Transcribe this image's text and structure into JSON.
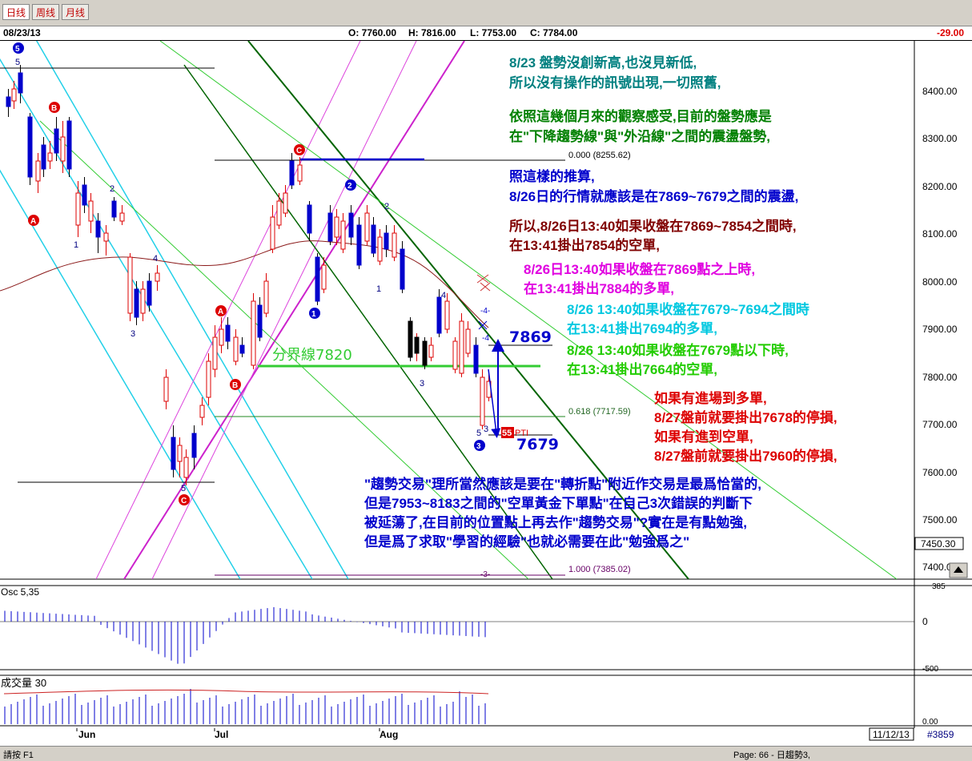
{
  "toolbar": {
    "tabs": [
      "日线",
      "周线",
      "月线"
    ],
    "active_tab": "日线"
  },
  "info": {
    "date": "08/23/13",
    "open": "O: 7760.00",
    "high": "H: 7816.00",
    "low": "L: 7753.00",
    "close": "C: 7784.00",
    "change": "-29.00"
  },
  "price_axis": {
    "labels": [
      "8400.00",
      "8300.00",
      "8200.00",
      "8100.00",
      "8000.00",
      "7900.00",
      "7800.00",
      "7700.00",
      "7600.00",
      "7500.00",
      "7400.00"
    ],
    "current_price": "7450.30"
  },
  "fib": {
    "level_0": "0.000 (8255.62)",
    "level_618": "0.618 (7717.59)",
    "level_1": "1.000 (7385.02)"
  },
  "chart_labels": {
    "boundary_line": "分界線7820",
    "target_high": "7869",
    "target_low": "7679",
    "pti_number": "55",
    "pti_text": "PTI",
    "channel_mark_4a": "-4-",
    "channel_mark_4b": "-4",
    "channel_mark_3": "-3-"
  },
  "wave_labels": {
    "circle_5": "5",
    "small_5_top": "5",
    "B1": "B",
    "A1": "A",
    "C1": "C",
    "circle_2": "2",
    "circle_1": "1",
    "A2": "A",
    "B2": "B",
    "C2": "C",
    "circle_3": "3",
    "w2a": "2",
    "w1a": "1",
    "w4a": "4",
    "w3a": "3",
    "w5a": "5",
    "w2b": "2",
    "w1b": "1",
    "w4b": "4",
    "w3b": "3",
    "w5b": "5",
    "w3c": "3"
  },
  "annotations": {
    "p1_l1": "8/23 盤勢沒創新高,也沒見新低,",
    "p1_l2": "所以沒有操作的訊號出現,一切照舊,",
    "p2_l1": "依照這幾個月來的觀察感受,目前的盤勢應是",
    "p2_l2": "在\"下降趨勢線\"與\"外沿線\"之間的震盪盤勢,",
    "p3_l1": "照這樣的推算,",
    "p3_l2": "8/26日的行情就應該是在7869~7679之間的震盪,",
    "p4_l1": "所以,8/26日13:40如果收盤在7869~7854之間時,",
    "p4_l2": "在13:41掛出7854的空單,",
    "p5_l1": "8/26日13:40如果收盤在7869點之上時,",
    "p5_l2": "在13:41掛出7884的多單,",
    "p6_l1": "8/26 13:40如果收盤在7679~7694之間時",
    "p6_l2": "在13:41掛出7694的多單,",
    "p7_l1": "8/26 13:40如果收盤在7679點以下時,",
    "p7_l2": "在13:41掛出7664的空單,",
    "p8_l1": "如果有進場到多單,",
    "p8_l2": "8/27盤前就要掛出7678的停損,",
    "p8_l3": "如果有進到空單,",
    "p8_l4": "8/27盤前就要掛出7960的停損,",
    "p9_l1": "\"趨勢交易\"理所當然應該是要在\"轉折點\"附近作交易是最爲恰當的,",
    "p9_l2": "但是7953~8183之間的\"空單黃金下單點\"在自己3次錯誤的判斷下",
    "p9_l3": "被延蕩了,在目前的位置點上再去作\"趨勢交易\"?實在是有點勉強,",
    "p9_l4": "但是爲了求取\"學習的經驗\"也就必需要在此\"勉強爲之\""
  },
  "osc": {
    "title": "Osc 5,35",
    "axis_top": "385",
    "axis_zero": "0",
    "axis_bottom": "-500"
  },
  "volume": {
    "title": "成交量 30",
    "axis_bottom": "0.00"
  },
  "time_axis": {
    "labels": [
      "Jun",
      "Jul",
      "Aug"
    ],
    "date_box": "11/12/13",
    "id_box": "#3859"
  },
  "status": {
    "left": "請按 F1",
    "page": "Page: 66 - 日趨勢3,"
  },
  "colors": {
    "up_candle": "#dd0000",
    "down_candle": "#0000cc",
    "teal_text": "#008080",
    "green_text": "#008000",
    "blue_text": "#0000cc",
    "maroon_text": "#800000",
    "magenta_text": "#e000e0",
    "cyan_text": "#00c8e0",
    "lime_text": "#22cc00",
    "red_text": "#dd0000"
  }
}
